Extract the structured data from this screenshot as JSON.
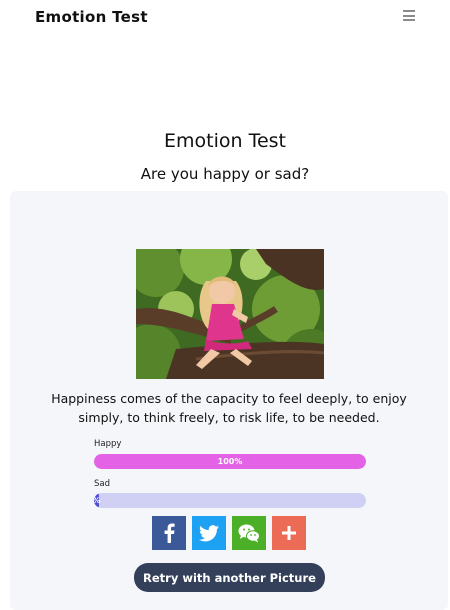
{
  "navbar": {
    "brand": "Emotion Test",
    "menu_icon": "hamburger-icon"
  },
  "header": {
    "title": "Emotion Test",
    "subtitle": "Are you happy or sad?"
  },
  "result": {
    "image_icon": "photo-girl-in-tree",
    "quote": "Happiness comes of the capacity to feel deeply, to enjoy simply, to think freely, to risk life, to be needed.",
    "bars": [
      {
        "label": "Happy",
        "percent": 100,
        "text": "100%",
        "color": "#e462e6"
      },
      {
        "label": "Sad",
        "percent": 0,
        "text": "%",
        "color": "#4e4fd6"
      }
    ],
    "track_color": "#cfd0f4"
  },
  "share": {
    "buttons": [
      {
        "icon": "facebook-icon",
        "color": "#3b5998"
      },
      {
        "icon": "twitter-icon",
        "color": "#1da1f2"
      },
      {
        "icon": "wechat-icon",
        "color": "#4caf28"
      },
      {
        "icon": "plus-icon",
        "color": "#ec6b57"
      }
    ]
  },
  "actions": {
    "retry_label": "Retry with another Picture"
  }
}
